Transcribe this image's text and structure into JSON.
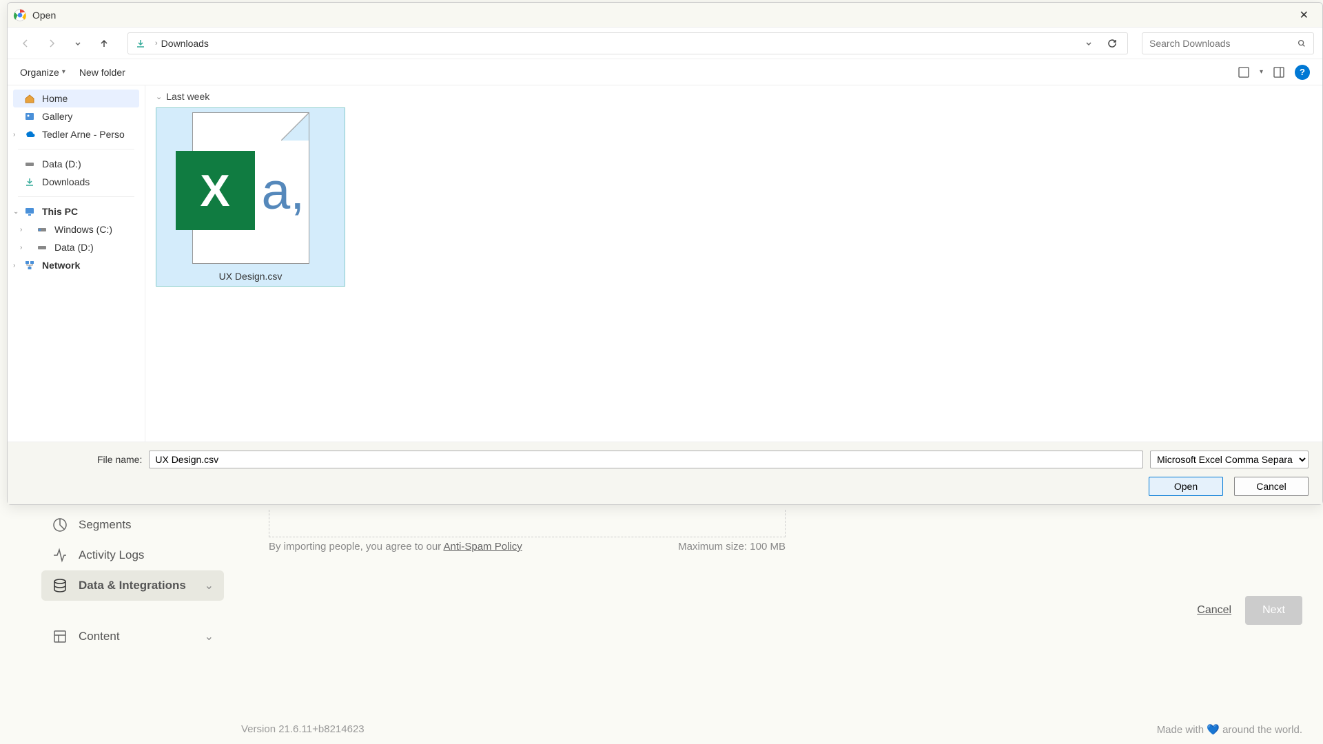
{
  "bg_app": {
    "sidebar": {
      "segments": "Segments",
      "activity_logs": "Activity Logs",
      "data_integrations": "Data & Integrations",
      "content": "Content"
    },
    "import_text_prefix": "By importing people, you agree to our ",
    "import_link": "Anti-Spam Policy",
    "max_size": "Maximum size: 100 MB",
    "cancel": "Cancel",
    "next": "Next",
    "version": "Version 21.6.11+b8214623",
    "footer_text": " around the world.",
    "footer_prefix": "Made with "
  },
  "dialog": {
    "title": "Open",
    "breadcrumb": "Downloads",
    "search_placeholder": "Search Downloads",
    "organize": "Organize",
    "new_folder": "New folder",
    "sidebar": {
      "home": "Home",
      "gallery": "Gallery",
      "onedrive": "Tedler Arne - Personal",
      "data_d": "Data (D:)",
      "downloads": "Downloads",
      "this_pc": "This PC",
      "windows_c": "Windows (C:)",
      "data_d2": "Data (D:)",
      "network": "Network"
    },
    "group_header": "Last week",
    "file_name": "UX Design.csv",
    "filename_label": "File name:",
    "filename_value": "UX Design.csv",
    "filetype": "Microsoft Excel Comma Separa",
    "open_btn": "Open",
    "cancel_btn": "Cancel"
  }
}
